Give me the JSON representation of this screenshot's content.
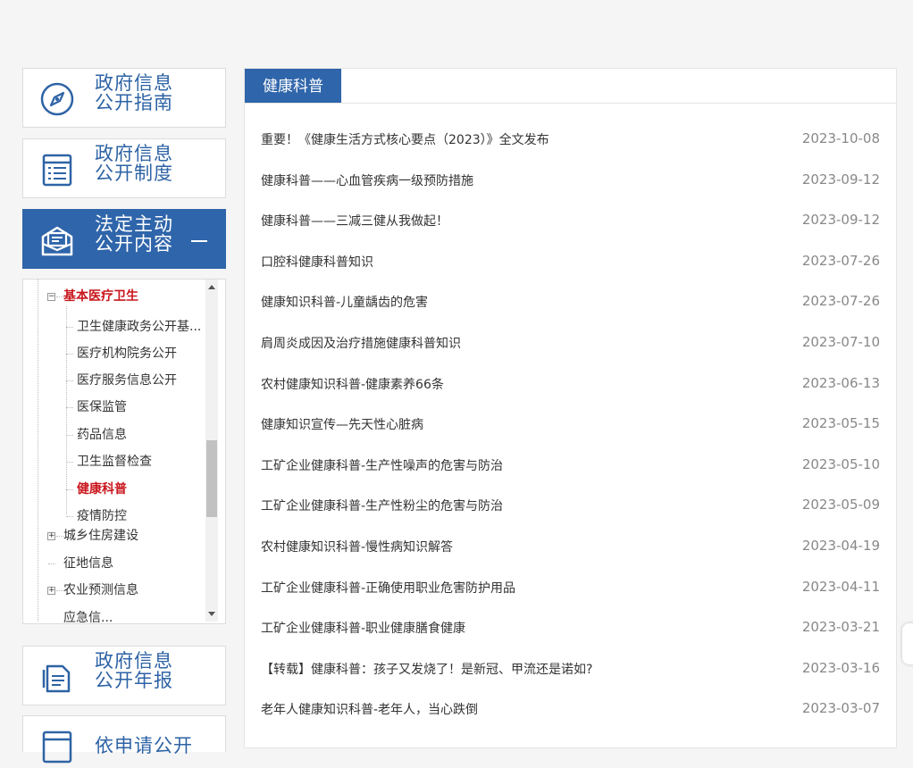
{
  "sidebar": {
    "boxes": [
      {
        "line1": "政府信息",
        "line2": "公开指南",
        "icon": "compass-icon"
      },
      {
        "line1": "政府信息",
        "line2": "公开制度",
        "icon": "list-icon"
      },
      {
        "line1": "法定主动",
        "line2": "公开内容",
        "icon": "inbox-icon",
        "toggle": "—"
      },
      {
        "line1": "政府信息",
        "line2": "公开年报",
        "icon": "document-icon"
      },
      {
        "line1": "依申请公开",
        "icon": "list-icon"
      }
    ],
    "tree": {
      "parent": "基本医疗卫生",
      "children": [
        "卫生健康政务公开基...",
        "医疗机构院务公开",
        "医疗服务信息公开",
        "医保监管",
        "药品信息",
        "卫生监督检查",
        "健康科普",
        "疫情防控"
      ],
      "siblings": [
        "城乡住房建设",
        "征地信息",
        "农业预测信息",
        "应急信..."
      ],
      "expand_symbol": "+",
      "collapse_symbol": "−"
    }
  },
  "main": {
    "tab_label": "健康科普",
    "news": [
      {
        "title": "重要！《健康生活方式核心要点（2023）》全文发布",
        "date": "2023-10-08"
      },
      {
        "title": "健康科普——心血管疾病一级预防措施",
        "date": "2023-09-12"
      },
      {
        "title": "健康科普——三减三健从我做起！",
        "date": "2023-09-12"
      },
      {
        "title": "口腔科健康科普知识",
        "date": "2023-07-26"
      },
      {
        "title": "健康知识科普-儿童龋齿的危害",
        "date": "2023-07-26"
      },
      {
        "title": "肩周炎成因及治疗措施健康科普知识",
        "date": "2023-07-10"
      },
      {
        "title": "农村健康知识科普-健康素养66条",
        "date": "2023-06-13"
      },
      {
        "title": "健康知识宣传—先天性心脏病",
        "date": "2023-05-15"
      },
      {
        "title": "工矿企业健康科普-生产性噪声的危害与防治",
        "date": "2023-05-10"
      },
      {
        "title": "工矿企业健康科普-生产性粉尘的危害与防治",
        "date": "2023-05-09"
      },
      {
        "title": "农村健康知识科普-慢性病知识解答",
        "date": "2023-04-19"
      },
      {
        "title": "工矿企业健康科普-正确使用职业危害防护用品",
        "date": "2023-04-11"
      },
      {
        "title": "工矿企业健康科普-职业健康膳食健康",
        "date": "2023-03-21"
      },
      {
        "title": "【转载】健康科普：孩子又发烧了！是新冠、甲流还是诺如?",
        "date": "2023-03-16"
      },
      {
        "title": "老年人健康知识科普-老年人，当心跌倒",
        "date": "2023-03-07"
      }
    ]
  },
  "colors": {
    "accent": "#2f65aa",
    "active_red": "#c9161d"
  }
}
